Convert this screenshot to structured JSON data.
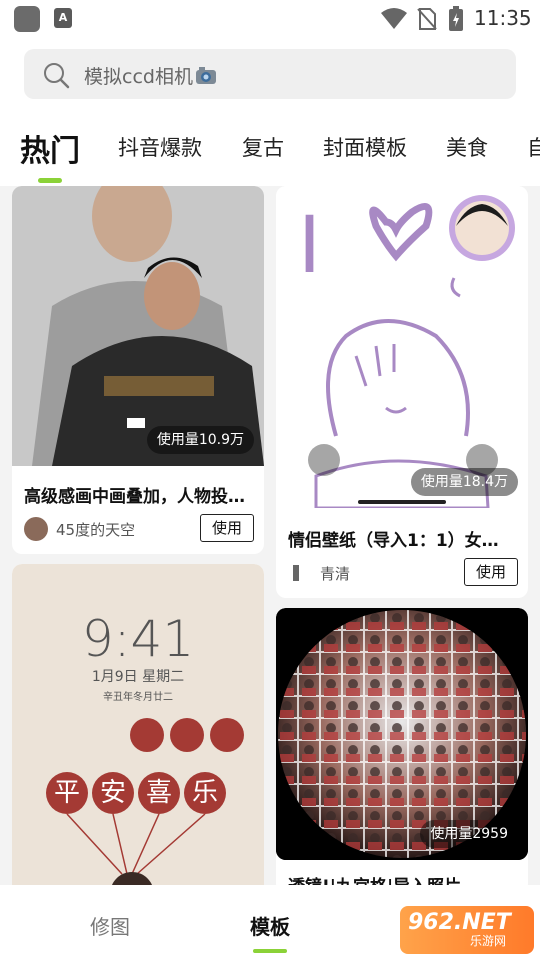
{
  "status_bar": {
    "time": "11:35"
  },
  "search": {
    "placeholder": "模拟ccd相机"
  },
  "tabs": [
    {
      "label": "热门",
      "active": true
    },
    {
      "label": "抖音爆款"
    },
    {
      "label": "复古"
    },
    {
      "label": "封面模板"
    },
    {
      "label": "美食"
    },
    {
      "label": "自"
    }
  ],
  "cards": [
    {
      "title": "高级感画中画叠加，人物投…",
      "author": "45度的天空",
      "usage": "使用量10.9万",
      "use_label": "使用"
    },
    {
      "title": "情侣壁纸（导入1：1）女…",
      "author": "青清",
      "usage": "使用量18.4万",
      "use_label": "使用"
    },
    {
      "lock_time": "9:41",
      "lock_date": "1月9日 星期二",
      "lock_lunar": "辛丑年冬月廿二",
      "lock_phrase": [
        "平",
        "安",
        "喜",
        "乐"
      ]
    },
    {
      "usage": "使用量2959",
      "title": "透镜!|九宫格|导入照片"
    }
  ],
  "doodle": {
    "text": "I"
  },
  "bottom_nav": [
    {
      "label": "修图"
    },
    {
      "label": "模板",
      "active": true
    }
  ],
  "watermark": {
    "brand": "962.NET",
    "sub": "乐游网"
  },
  "colors": {
    "accent": "#8bd238"
  }
}
